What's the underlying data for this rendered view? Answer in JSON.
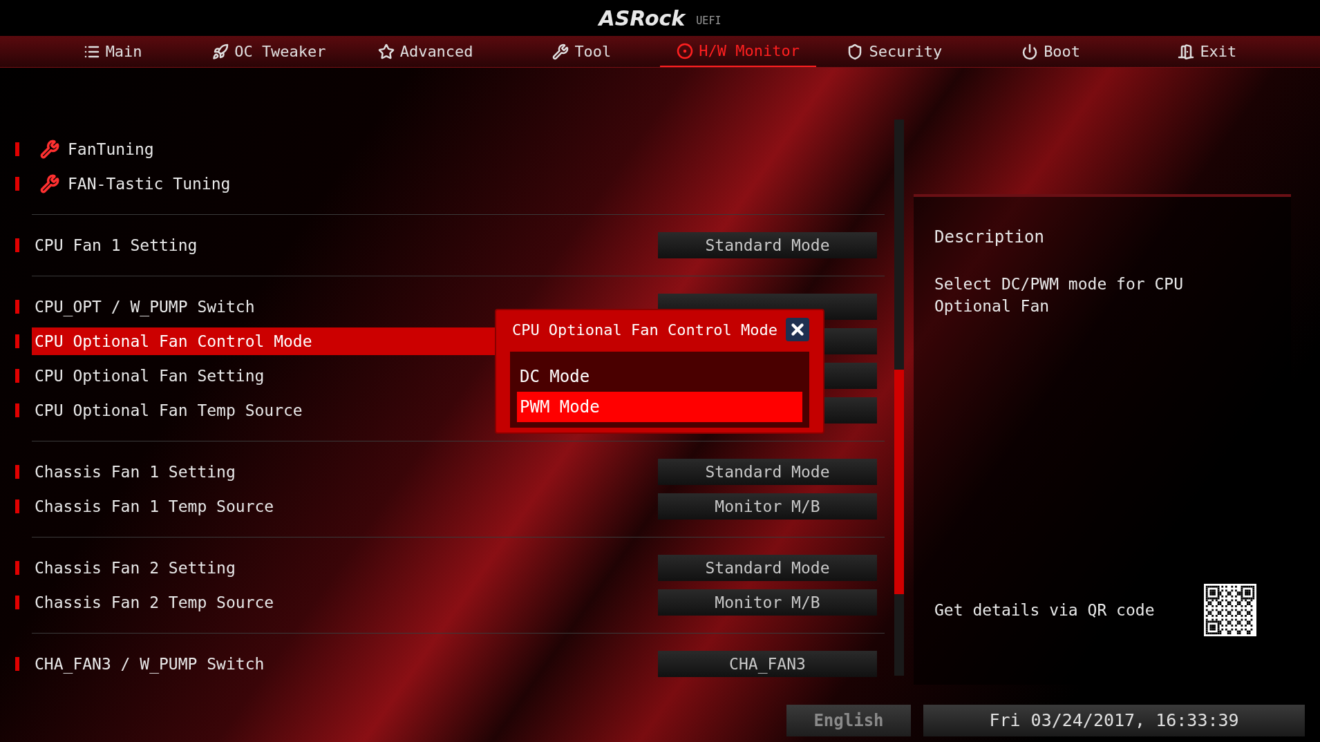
{
  "header": {
    "logo": "ASRock",
    "suffix": "UEFI"
  },
  "tabs": [
    {
      "label": "Main",
      "selected": false
    },
    {
      "label": "OC Tweaker",
      "selected": false
    },
    {
      "label": "Advanced",
      "selected": false
    },
    {
      "label": "Tool",
      "selected": false
    },
    {
      "label": "H/W Monitor",
      "selected": true
    },
    {
      "label": "Security",
      "selected": false
    },
    {
      "label": "Boot",
      "selected": false
    },
    {
      "label": "Exit",
      "selected": false
    }
  ],
  "menu": {
    "groups": [
      {
        "items": [
          {
            "kind": "link",
            "label": "FanTuning",
            "selected": false
          },
          {
            "kind": "link",
            "label": "FAN-Tastic Tuning",
            "selected": false
          }
        ]
      },
      {
        "items": [
          {
            "kind": "setting",
            "label": "CPU Fan 1 Setting",
            "value": "Standard Mode",
            "selected": false
          }
        ]
      },
      {
        "items": [
          {
            "kind": "setting",
            "label": "CPU_OPT / W_PUMP Switch",
            "selected": false
          },
          {
            "kind": "setting",
            "label": "CPU Optional Fan Control Mode",
            "selected": true
          },
          {
            "kind": "setting",
            "label": "CPU Optional Fan Setting",
            "selected": false
          },
          {
            "kind": "setting",
            "label": "CPU Optional Fan Temp Source",
            "selected": false
          }
        ]
      },
      {
        "items": [
          {
            "kind": "setting",
            "label": "Chassis Fan 1 Setting",
            "value": "Standard Mode",
            "selected": false
          },
          {
            "kind": "setting",
            "label": "Chassis Fan 1 Temp Source",
            "value": "Monitor M/B",
            "selected": false
          }
        ]
      },
      {
        "items": [
          {
            "kind": "setting",
            "label": "Chassis Fan 2 Setting",
            "value": "Standard Mode",
            "selected": false
          },
          {
            "kind": "setting",
            "label": "Chassis Fan 2 Temp Source",
            "value": "Monitor M/B",
            "selected": false
          }
        ]
      },
      {
        "items": [
          {
            "kind": "setting",
            "label": "CHA_FAN3 / W_PUMP Switch",
            "value": "CHA_FAN3",
            "selected": false
          }
        ]
      }
    ]
  },
  "popup": {
    "title": "CPU Optional Fan Control Mode",
    "options": [
      {
        "label": "DC Mode",
        "selected": false
      },
      {
        "label": "PWM Mode",
        "selected": true
      }
    ]
  },
  "description": {
    "heading": "Description",
    "text": "Select DC/PWM mode for CPU Optional Fan",
    "qr_label": "Get details via QR code"
  },
  "footer": {
    "language": "English",
    "datetime": "Fri 03/24/2017, 16:33:39"
  }
}
